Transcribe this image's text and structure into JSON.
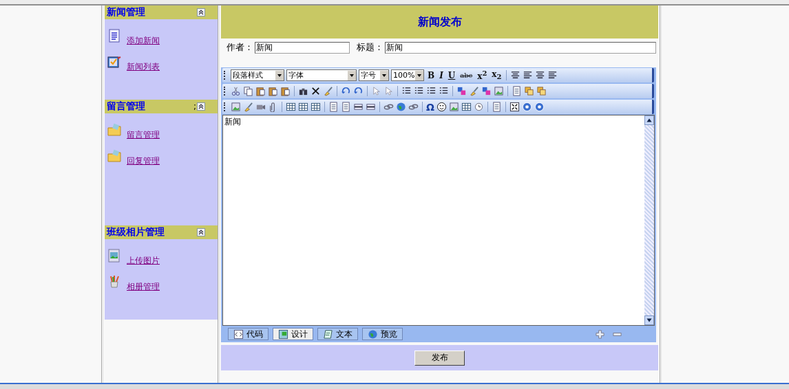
{
  "sidebar": {
    "sections": [
      {
        "title": "新闻管理",
        "items": [
          {
            "label": "添加新闻",
            "kind": "document"
          },
          {
            "label": "新闻列表",
            "kind": "checklist"
          }
        ]
      },
      {
        "title": "留言管理",
        "prefix": ";",
        "items": [
          {
            "label": "留言管理",
            "kind": "folder"
          },
          {
            "label": "回复管理",
            "kind": "folder"
          }
        ]
      },
      {
        "title": "班级相片管理",
        "items": [
          {
            "label": "上传图片",
            "kind": "picture"
          },
          {
            "label": "相册管理",
            "kind": "brushes"
          }
        ]
      }
    ]
  },
  "page_header": {
    "title": "新闻发布"
  },
  "form": {
    "author": {
      "label": "作者：",
      "value": "新闻"
    },
    "title": {
      "label": "标题：",
      "value": "新闻"
    }
  },
  "toolbar": {
    "selects": [
      {
        "label": "段落样式"
      },
      {
        "label": "字体"
      },
      {
        "label": "字号"
      },
      {
        "label": "100%"
      }
    ],
    "format_glyphs": [
      "B",
      "I",
      "U",
      "abc",
      "x$^{2}$",
      "x$_{2}$"
    ],
    "symbol": "Ω"
  },
  "editor": {
    "content": "新闻"
  },
  "view_tabs": [
    {
      "label": "代码",
      "kind": "code",
      "selected": false
    },
    {
      "label": "设计",
      "kind": "design",
      "selected": true
    },
    {
      "label": "文本",
      "kind": "text",
      "selected": false
    },
    {
      "label": "预览",
      "kind": "preview",
      "selected": false
    }
  ],
  "publish_button": "发布"
}
